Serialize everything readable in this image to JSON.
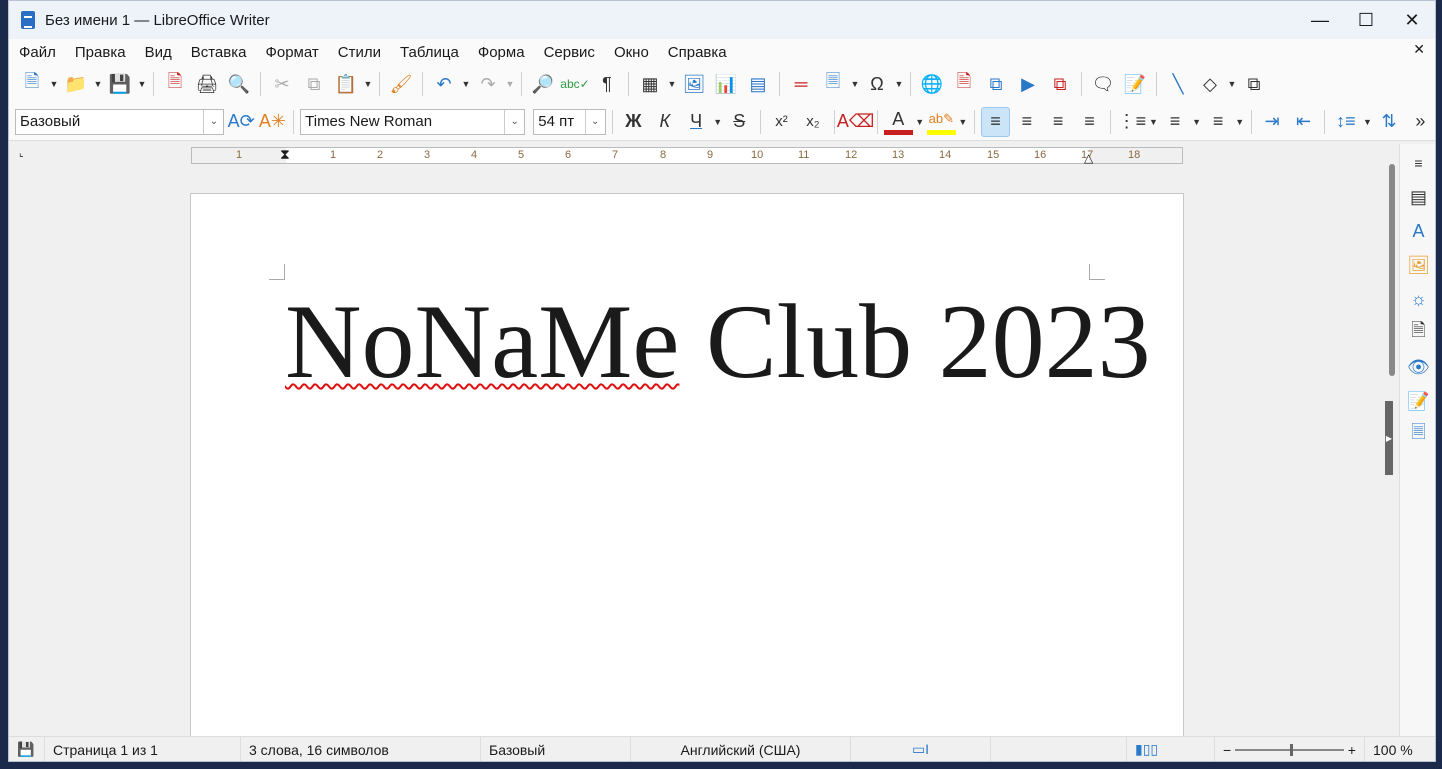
{
  "window": {
    "title": "Без имени 1 — LibreOffice Writer"
  },
  "menu": [
    "Файл",
    "Правка",
    "Вид",
    "Вставка",
    "Формат",
    "Стили",
    "Таблица",
    "Форма",
    "Сервис",
    "Окно",
    "Справка"
  ],
  "format_bar": {
    "paragraph_style": "Базовый",
    "font_name": "Times New Roman",
    "font_size": "54 пт",
    "bold": "Ж",
    "italic": "К",
    "underline": "Ч"
  },
  "ruler": {
    "numbers": [
      "1",
      "1",
      "2",
      "3",
      "4",
      "5",
      "6",
      "7",
      "8",
      "9",
      "10",
      "11",
      "12",
      "13",
      "14",
      "15",
      "16",
      "17",
      "18"
    ]
  },
  "document": {
    "misspelled_word": "NoNaMe",
    "rest_text": " Club 2023"
  },
  "status": {
    "page": "Страница 1 из 1",
    "words": "3 слова, 16 символов",
    "style": "Базовый",
    "language": "Английский (США)",
    "zoom": "100 %"
  },
  "colors": {
    "font_color": "#c82020",
    "highlight_color": "#ffff00",
    "accent": "#2a78c8"
  }
}
